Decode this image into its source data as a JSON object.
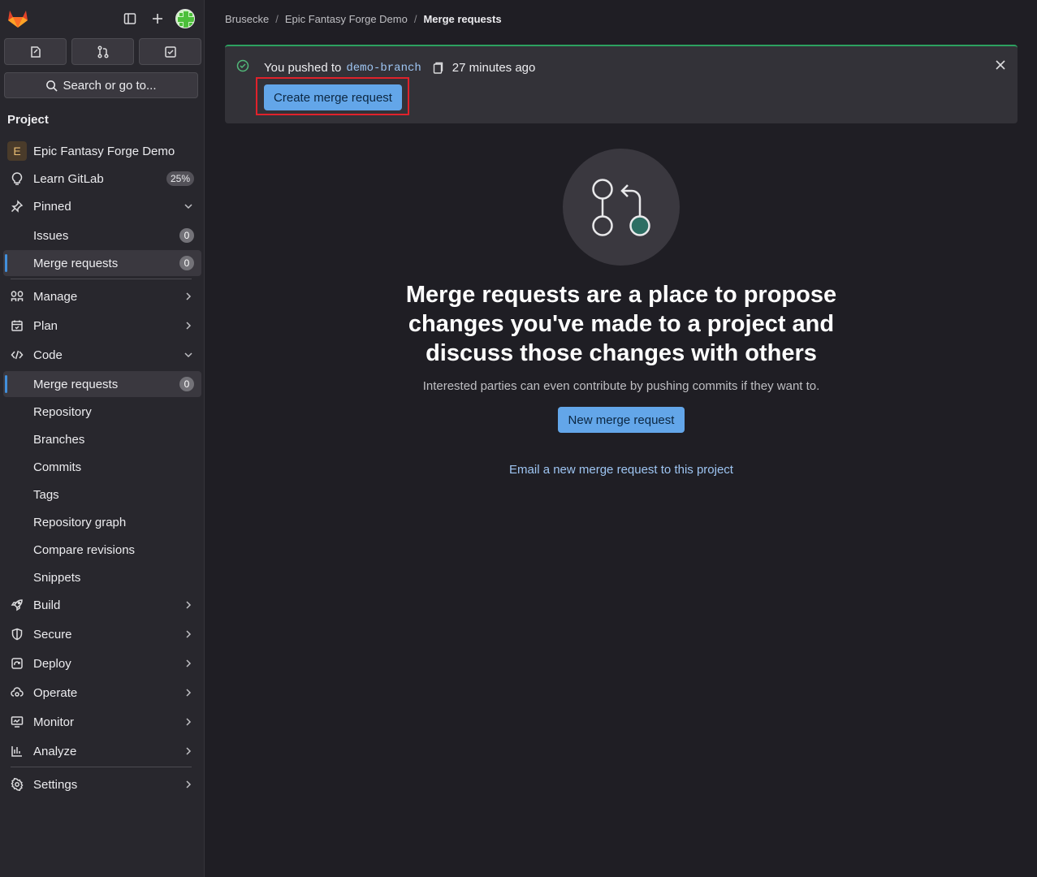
{
  "sidebar": {
    "section_title": "Project",
    "search_label": "Search or go to...",
    "project": {
      "initial": "E",
      "name": "Epic Fantasy Forge Demo"
    },
    "learn": {
      "label": "Learn GitLab",
      "progress": "25%"
    },
    "pinned": {
      "label": "Pinned",
      "items": [
        {
          "label": "Issues",
          "count": "0"
        },
        {
          "label": "Merge requests",
          "count": "0"
        }
      ]
    },
    "manage": "Manage",
    "plan": "Plan",
    "code": {
      "label": "Code",
      "items": [
        {
          "label": "Merge requests",
          "count": "0"
        },
        {
          "label": "Repository"
        },
        {
          "label": "Branches"
        },
        {
          "label": "Commits"
        },
        {
          "label": "Tags"
        },
        {
          "label": "Repository graph"
        },
        {
          "label": "Compare revisions"
        },
        {
          "label": "Snippets"
        }
      ]
    },
    "build": "Build",
    "secure": "Secure",
    "deploy": "Deploy",
    "operate": "Operate",
    "monitor": "Monitor",
    "analyze": "Analyze",
    "settings": "Settings"
  },
  "breadcrumb": [
    "Brusecke",
    "Epic Fantasy Forge Demo",
    "Merge requests"
  ],
  "alert": {
    "prefix": "You pushed to",
    "branch": "demo-branch",
    "time": "27 minutes ago",
    "button": "Create merge request"
  },
  "empty_state": {
    "title": "Merge requests are a place to propose changes you've made to a project and discuss those changes with others",
    "subtitle": "Interested parties can even contribute by pushing commits if they want to.",
    "button": "New merge request",
    "link": "Email a new merge request to this project"
  },
  "colors": {
    "accent": "#63a6e9",
    "highlight": "#e0222b",
    "success": "#52b87a"
  }
}
